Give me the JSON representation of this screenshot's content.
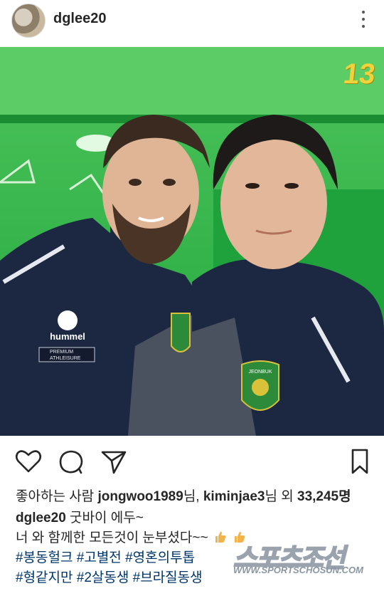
{
  "post": {
    "username": "dglee20",
    "locker_number": "13"
  },
  "likes": {
    "prefix": "좋아하는 사람 ",
    "user1": "jongwoo1989",
    "sep1": "님, ",
    "user2": "kiminjae3",
    "sep2": "님 외 ",
    "count": "33,245명"
  },
  "caption": {
    "author": "dglee20",
    "line1": " 굿바이 에두~",
    "line2": "너 와 함께한 모든것이 눈부셨다~~"
  },
  "hashtags": {
    "row1": [
      "#봉동헐크",
      "#고별전",
      "#영혼의투톱"
    ],
    "row2": [
      "#형같지만",
      "#2살동생",
      "#브라질동생"
    ]
  },
  "jersey": {
    "brand": "hummel",
    "tagline_1": "PREMIUM",
    "tagline_2": "ATHLEISURE",
    "crest_text": "JEONBUK"
  },
  "watermark": {
    "logo": "스포츠조선",
    "url": "WWW.SPORTSCHOSUN.COM"
  },
  "icons": {
    "like": "heart-icon",
    "comment": "comment-icon",
    "share": "send-icon",
    "save": "bookmark-icon",
    "more": "more-icon"
  },
  "colors": {
    "locker_green": "#2fb24a",
    "jacket_navy": "#1c2741",
    "hashtag_blue": "#003569"
  }
}
